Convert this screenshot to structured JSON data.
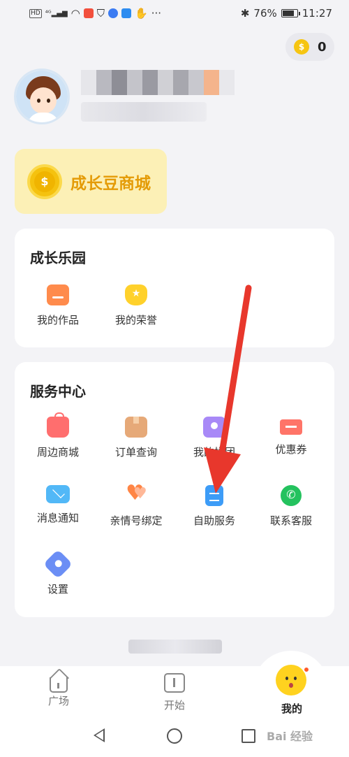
{
  "status_bar": {
    "left_icons": [
      "HD",
      "4G",
      "signal",
      "wifi",
      "app-red",
      "shield",
      "app-blue",
      "cloud",
      "hand"
    ],
    "more": "···",
    "battery_pct": "76%",
    "time": "11:27"
  },
  "header": {
    "coin_balance": "0"
  },
  "mall": {
    "title": "成长豆商城"
  },
  "growth_park": {
    "title": "成长乐园",
    "items": [
      {
        "label": "我的作品",
        "icon": "works-icon"
      },
      {
        "label": "我的荣誉",
        "icon": "honor-icon"
      }
    ]
  },
  "service_center": {
    "title": "服务中心",
    "items": [
      {
        "label": "周边商城",
        "icon": "shop-bag-icon"
      },
      {
        "label": "订单查询",
        "icon": "order-box-icon"
      },
      {
        "label": "我的拼团",
        "icon": "group-buy-icon"
      },
      {
        "label": "优惠券",
        "icon": "coupon-icon"
      },
      {
        "label": "消息通知",
        "icon": "envelope-icon"
      },
      {
        "label": "亲情号绑定",
        "icon": "hearts-icon"
      },
      {
        "label": "自助服务",
        "icon": "self-service-icon"
      },
      {
        "label": "联系客服",
        "icon": "chat-icon"
      },
      {
        "label": "设置",
        "icon": "settings-icon"
      }
    ]
  },
  "tabbar": {
    "tabs": [
      {
        "label": "广场",
        "icon": "home-icon"
      },
      {
        "label": "开始",
        "icon": "start-icon"
      },
      {
        "label": "我的",
        "icon": "mine-face-icon",
        "active": true
      }
    ]
  },
  "navbar": {
    "watermark": "Bai 经验"
  },
  "colors": {
    "accent_yellow": "#f6c512",
    "mall_bg": "#fcf0b6",
    "annotation_arrow": "#e8372c"
  }
}
